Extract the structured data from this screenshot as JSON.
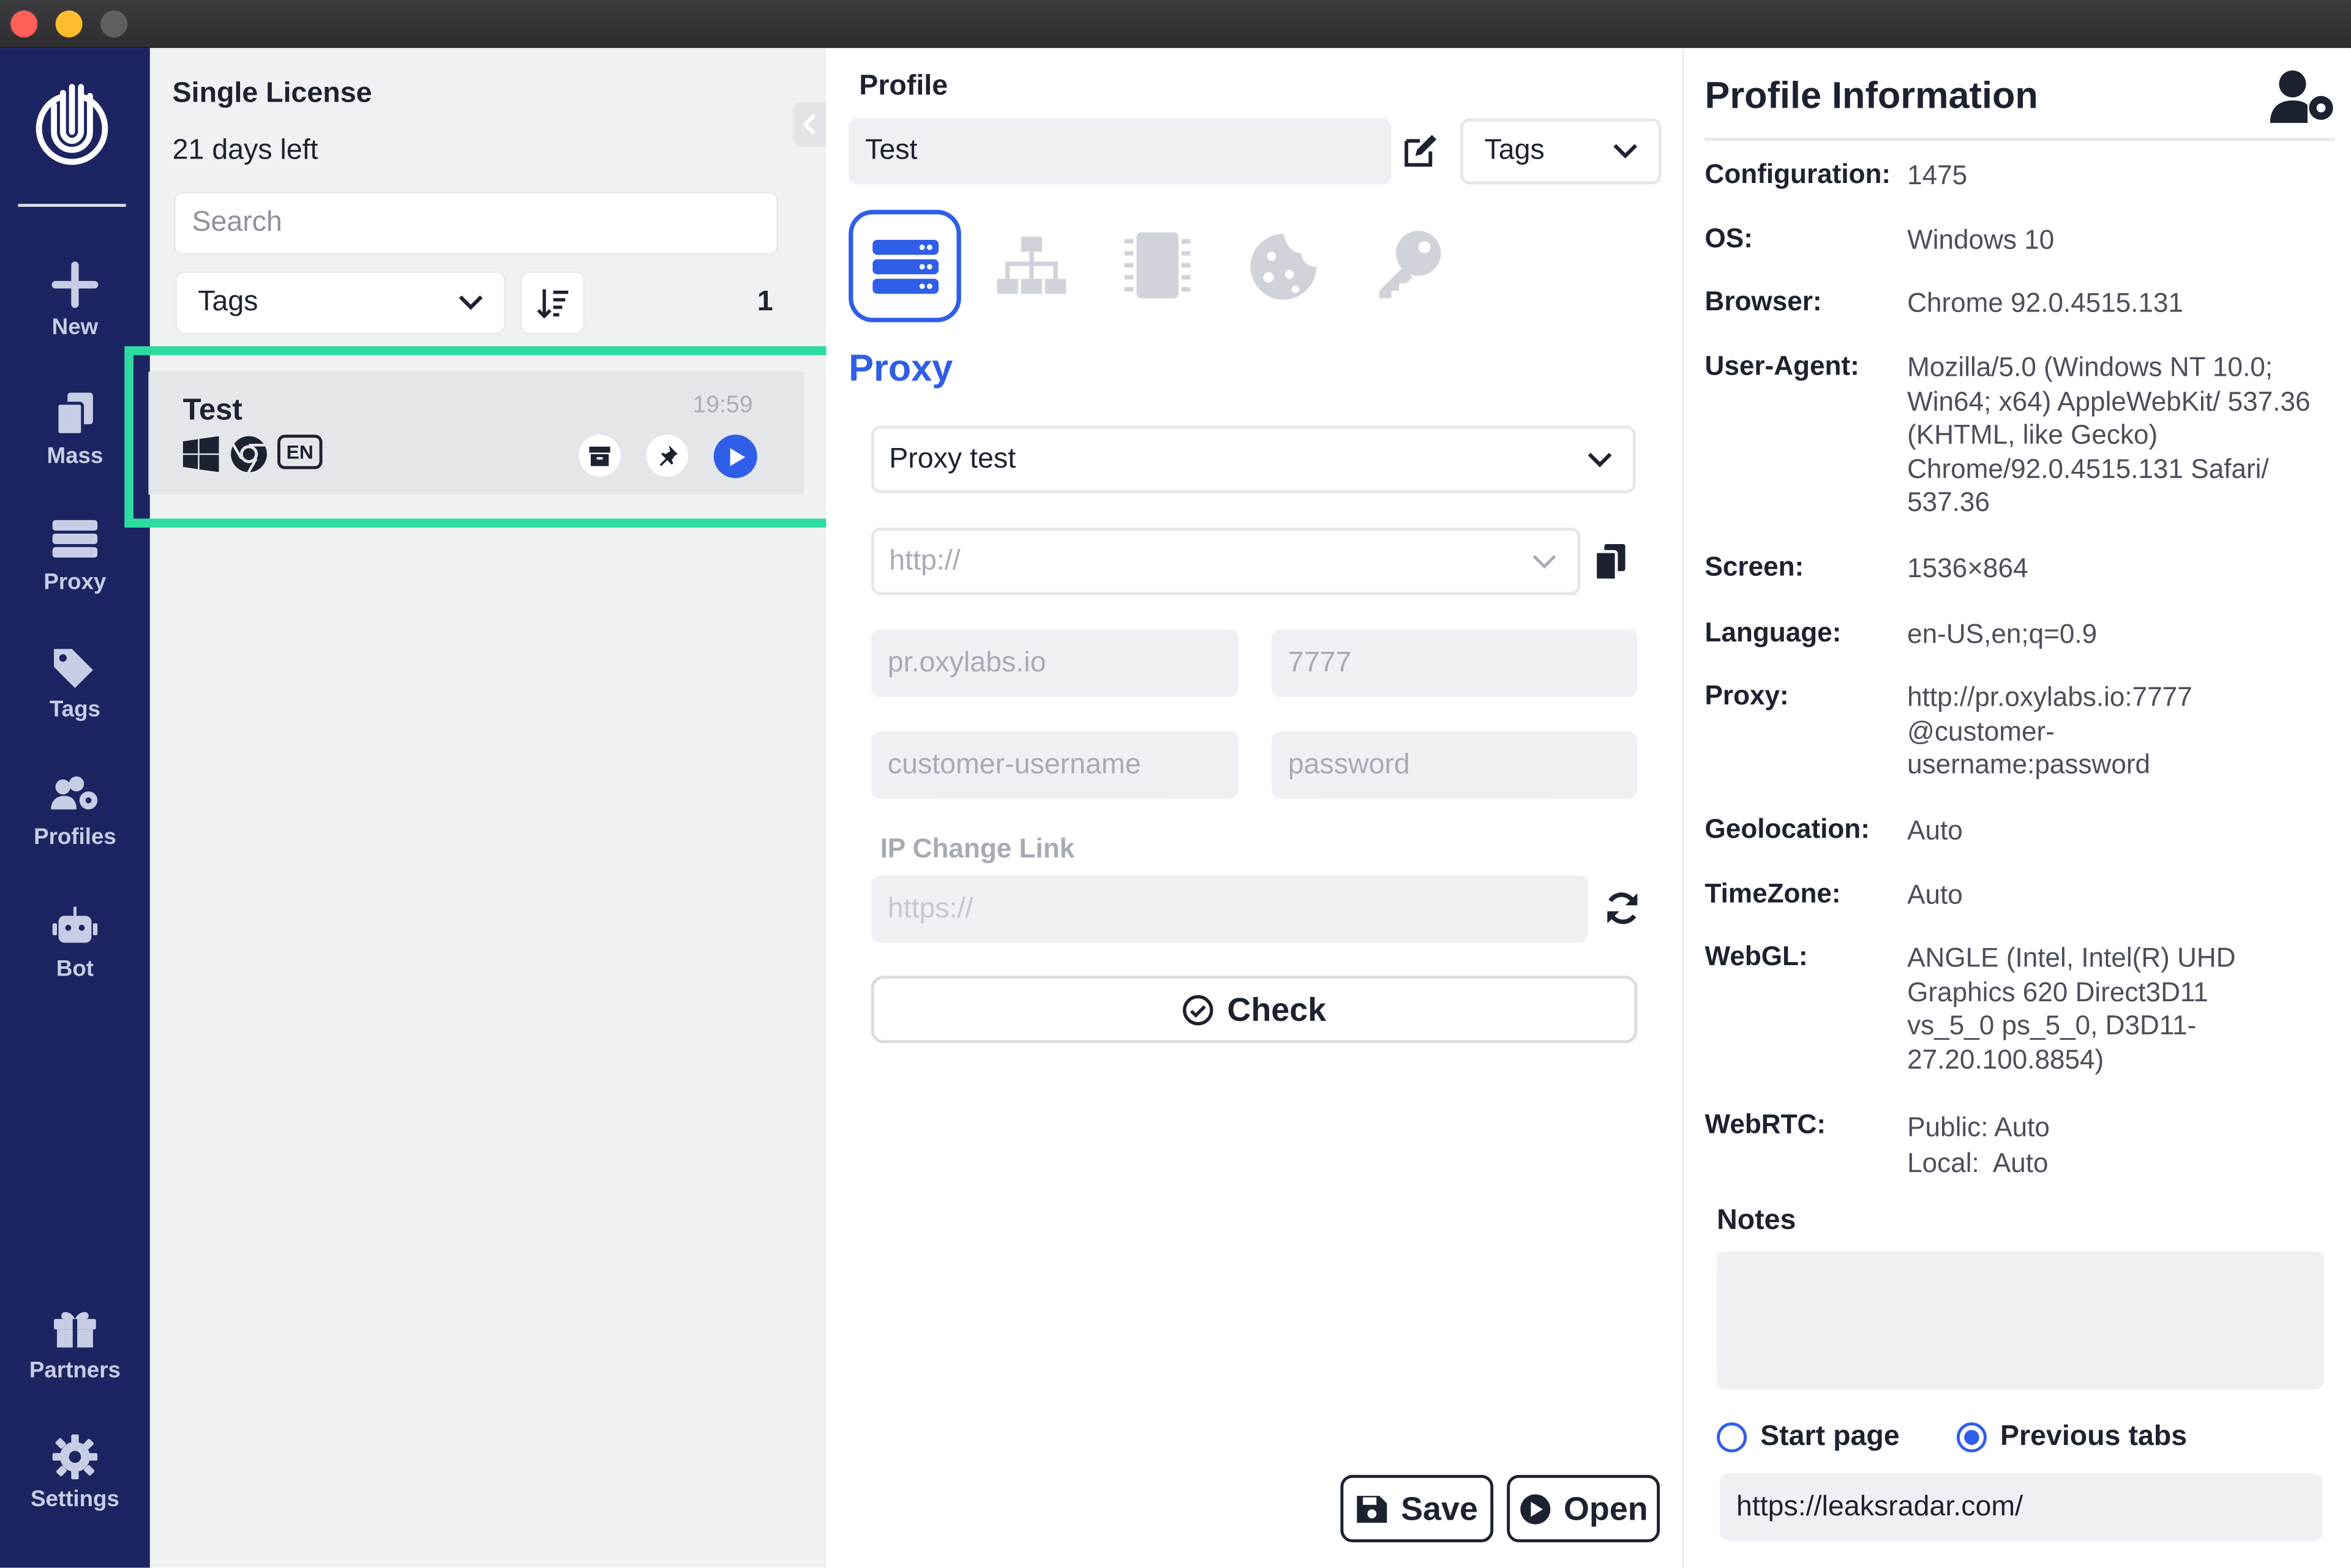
{
  "window": {
    "traffic_lights": [
      "close",
      "minimize",
      "maximize"
    ]
  },
  "nav": {
    "items": [
      {
        "label": "New",
        "icon": "plus-icon"
      },
      {
        "label": "Mass",
        "icon": "copy-icon"
      },
      {
        "label": "Proxy",
        "icon": "server-icon"
      },
      {
        "label": "Tags",
        "icon": "tags-icon"
      },
      {
        "label": "Profiles",
        "icon": "users-gear-icon"
      },
      {
        "label": "Bot",
        "icon": "robot-icon"
      }
    ],
    "bottom": [
      {
        "label": "Partners",
        "icon": "gift-icon"
      },
      {
        "label": "Settings",
        "icon": "gear-icon"
      }
    ]
  },
  "license": {
    "title": "Single License",
    "days_left": "21 days left"
  },
  "list": {
    "search_placeholder": "Search",
    "tags_label": "Tags",
    "count": "1",
    "profiles": [
      {
        "name": "Test",
        "time": "19:59",
        "os_icon": "windows-icon",
        "browser_icon": "chrome-icon",
        "lang": "EN"
      }
    ]
  },
  "profile": {
    "section_label": "Profile",
    "name_value": "Test",
    "tags_label": "Tags",
    "tabs": [
      "proxy-tab",
      "network-tab",
      "hardware-tab",
      "cookies-tab",
      "keys-tab"
    ],
    "active_tab_title": "Proxy",
    "proxy_select": "Proxy test",
    "protocol_placeholder": "http://",
    "host_placeholder": "pr.oxylabs.io",
    "port_placeholder": "7777",
    "username_placeholder": "customer-username",
    "password_placeholder": "password",
    "ip_change_label": "IP Change Link",
    "ip_change_placeholder": "https://",
    "check_label": "Check",
    "save_label": "Save",
    "open_label": "Open"
  },
  "info": {
    "title": "Profile Information",
    "rows": [
      {
        "label": "Configuration:",
        "value": "1475"
      },
      {
        "label": "OS:",
        "value": "Windows 10"
      },
      {
        "label": "Browser:",
        "value": "Chrome 92.0.4515.131"
      },
      {
        "label": "User-Agent:",
        "value": "Mozilla/5.0 (Windows NT 10.0; Win64; x64) AppleWebKit/ 537.36 (KHTML, like Gecko) Chrome/92.0.4515.131 Safari/ 537.36"
      },
      {
        "label": "Screen:",
        "value": "1536×864"
      },
      {
        "label": "Language:",
        "value": "en-US,en;q=0.9"
      },
      {
        "label": "Proxy:",
        "value": "http://pr.oxylabs.io:7777 @customer- username:password"
      },
      {
        "label": "Geolocation:",
        "value": "Auto"
      },
      {
        "label": "TimeZone:",
        "value": "Auto"
      },
      {
        "label": "WebGL:",
        "value": "ANGLE (Intel, Intel(R) UHD Graphics 620 Direct3D11 vs_5_0 ps_5_0, D3D11-27.20.100.8854)"
      },
      {
        "label": "WebRTC:",
        "value": "Public: Auto\nLocal:  Auto"
      }
    ],
    "notes_label": "Notes",
    "notes_value": "",
    "start_page_label": "Start page",
    "previous_tabs_label": "Previous tabs",
    "selected_start_option": "Previous tabs",
    "start_url": "https://leaksradar.com/"
  },
  "colors": {
    "nav_bg": "#1c2561",
    "accent": "#2f5ee8",
    "highlight": "#2ddba0"
  }
}
